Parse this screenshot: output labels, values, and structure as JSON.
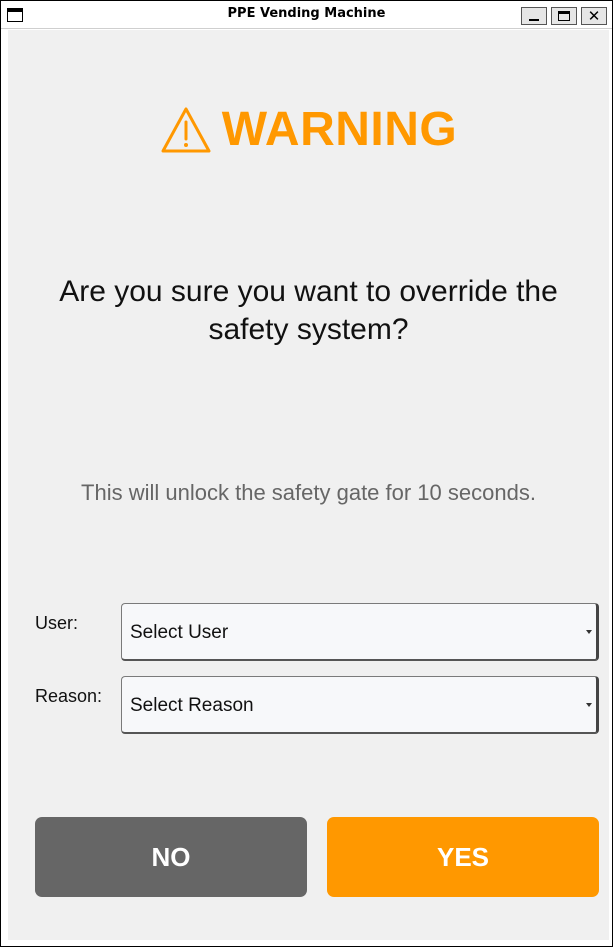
{
  "window": {
    "title": "PPE Vending Machine",
    "controls": {
      "minimize": "minimize",
      "maximize": "maximize",
      "close": "close"
    }
  },
  "dialog": {
    "warning_icon": "warning-triangle-icon",
    "warning_title": "WARNING",
    "question": "Are you sure you want to override the safety system?",
    "info": "This will unlock the safety gate for 10 seconds.",
    "fields": {
      "user": {
        "label": "User:",
        "selected": "Select User"
      },
      "reason": {
        "label": "Reason:",
        "selected": "Select Reason"
      }
    },
    "buttons": {
      "no": "NO",
      "yes": "YES"
    }
  },
  "colors": {
    "accent": "#ff9800",
    "no_button": "#666666",
    "info_text": "#666666",
    "background": "#f0f0f0"
  }
}
